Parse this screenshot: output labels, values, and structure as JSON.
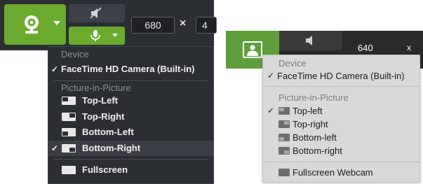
{
  "left": {
    "width_value": "680",
    "height_value": "4",
    "times_symbol": "×",
    "menu": {
      "device_header": "Device",
      "device_item": "FaceTime HD Camera (Built-in)",
      "pip_header": "Picture-in-Picture",
      "positions": [
        "Top-Left",
        "Top-Right",
        "Bottom-Left",
        "Bottom-Right"
      ],
      "fullscreen": "Fullscreen",
      "check": "✓"
    }
  },
  "right": {
    "width_value": "640",
    "times_symbol": "x",
    "menu": {
      "device_header": "Device",
      "device_item": "FaceTime HD Camera (Built-in)",
      "pip_header": "Picture-in-Picture",
      "positions": [
        "Top-left",
        "Top-right",
        "Bottom-left",
        "Bottom-right"
      ],
      "fullscreen": "Fullscreen Webcam",
      "check": "✓"
    }
  },
  "colors": {
    "accent_green": "#6aab2e",
    "right_accent_green": "#5f9e3a",
    "dark_panel": "#2b2e33",
    "light_menu": "#d9d9d9"
  },
  "icons": {
    "left_camera": "webcam-icon",
    "left_mute": "speaker-muted-icon",
    "left_mic": "microphone-icon",
    "right_camera": "picture-person-icon",
    "right_speaker": "speaker-icon"
  }
}
